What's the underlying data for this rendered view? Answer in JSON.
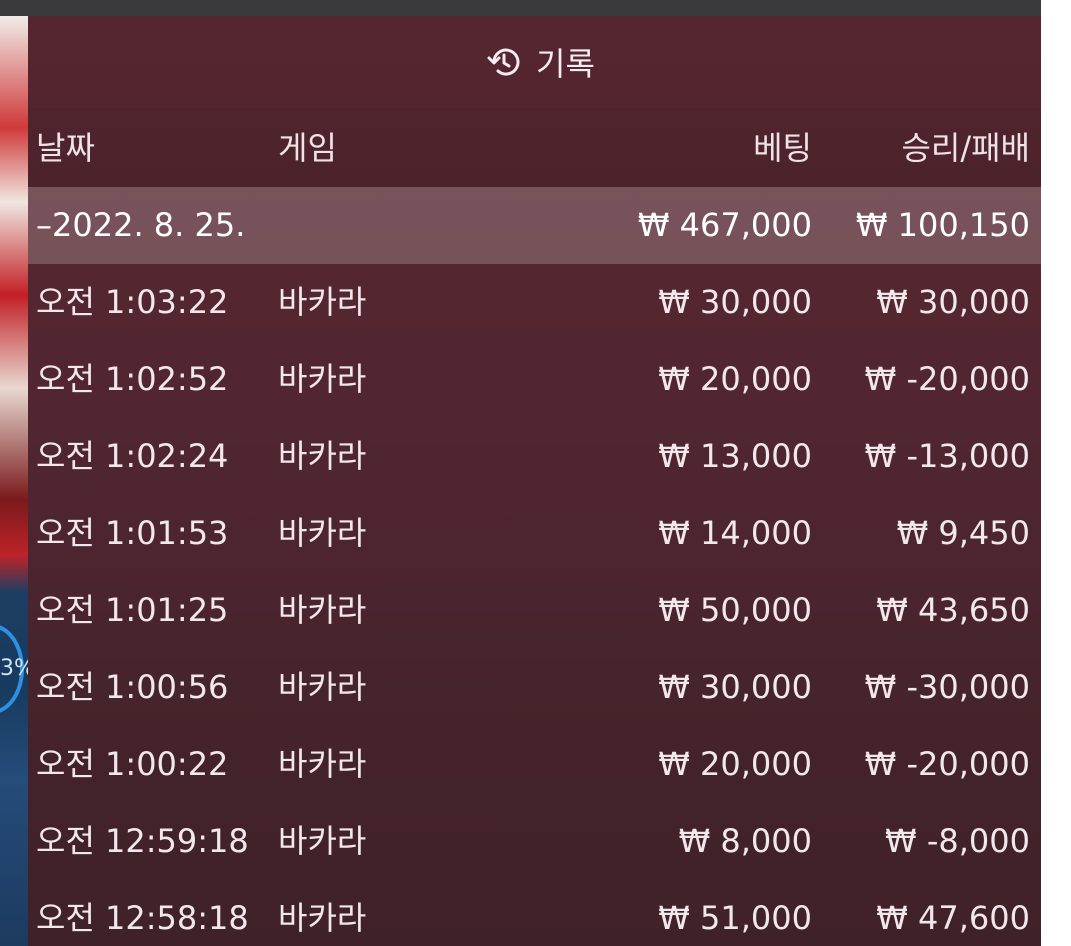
{
  "header": {
    "title": "기록",
    "icon": "history-icon"
  },
  "columns": {
    "date": "날짜",
    "game": "게임",
    "bet": "베팅",
    "winloss": "승리/패배"
  },
  "group": {
    "date": "–2022. 8. 25.",
    "bet": "₩ 467,000",
    "winloss": "₩ 100,150"
  },
  "rows": [
    {
      "time": "오전 1:03:22",
      "game": "바카라",
      "bet": "₩ 30,000",
      "winloss": "₩ 30,000"
    },
    {
      "time": "오전 1:02:52",
      "game": "바카라",
      "bet": "₩ 20,000",
      "winloss": "₩ -20,000"
    },
    {
      "time": "오전 1:02:24",
      "game": "바카라",
      "bet": "₩ 13,000",
      "winloss": "₩ -13,000"
    },
    {
      "time": "오전 1:01:53",
      "game": "바카라",
      "bet": "₩ 14,000",
      "winloss": "₩ 9,450"
    },
    {
      "time": "오전 1:01:25",
      "game": "바카라",
      "bet": "₩ 50,000",
      "winloss": "₩ 43,650"
    },
    {
      "time": "오전 1:00:56",
      "game": "바카라",
      "bet": "₩ 30,000",
      "winloss": "₩ -30,000"
    },
    {
      "time": "오전 1:00:22",
      "game": "바카라",
      "bet": "₩ 20,000",
      "winloss": "₩ -20,000"
    },
    {
      "time": "오전 12:59:18",
      "game": "바카라",
      "bet": "₩ 8,000",
      "winloss": "₩ -8,000"
    },
    {
      "time": "오전 12:58:18",
      "game": "바카라",
      "bet": "₩ 51,000",
      "winloss": "₩ 47,600"
    }
  ],
  "side_badge": {
    "text": "3%"
  }
}
